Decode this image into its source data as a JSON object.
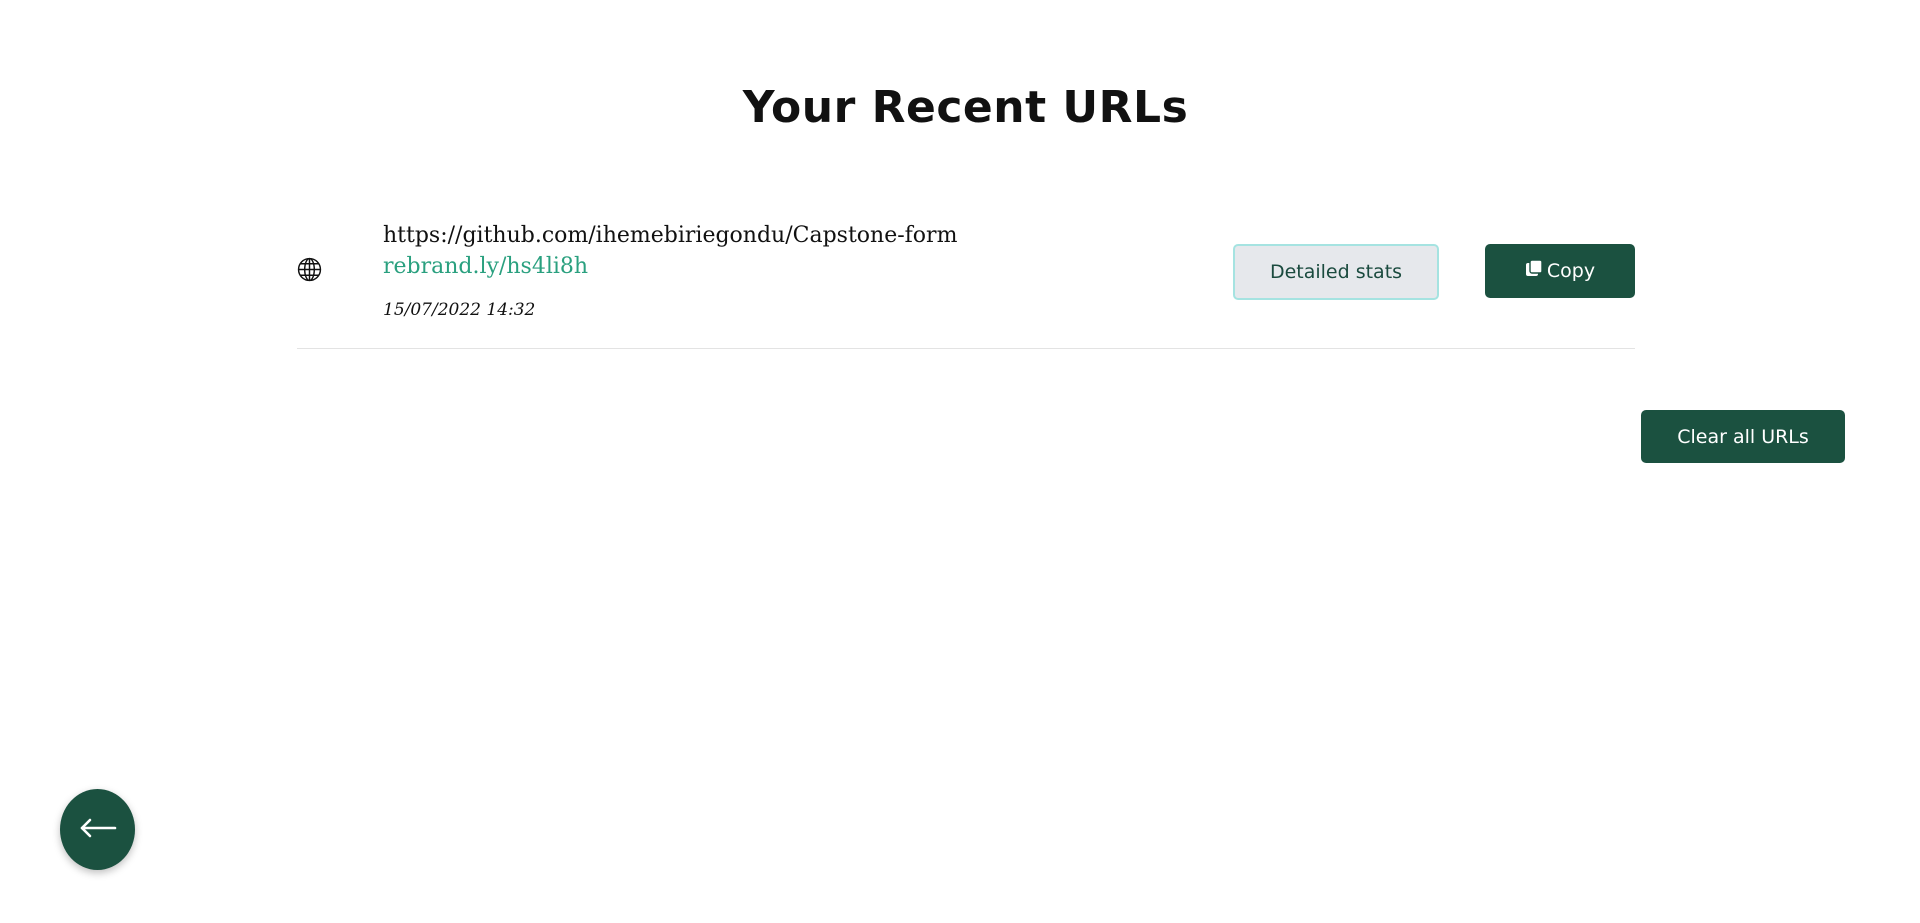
{
  "header": {
    "title": "Your Recent URLs"
  },
  "urls": [
    {
      "original": "https://github.com/ihemebiriegondu/Capstone-form",
      "short": "rebrand.ly/hs4li8h",
      "created": "15/07/2022 14:32",
      "stats_label": "Detailed stats",
      "copy_label": "Copy",
      "icon": "globe-icon"
    }
  ],
  "actions": {
    "clear_label": "Clear all URLs",
    "back_icon": "arrow-left-icon"
  },
  "colors": {
    "brand": "#1b5140",
    "link": "#2aa07f",
    "stats_bg": "#e6e8ec",
    "stats_border": "#a5e3e1"
  }
}
